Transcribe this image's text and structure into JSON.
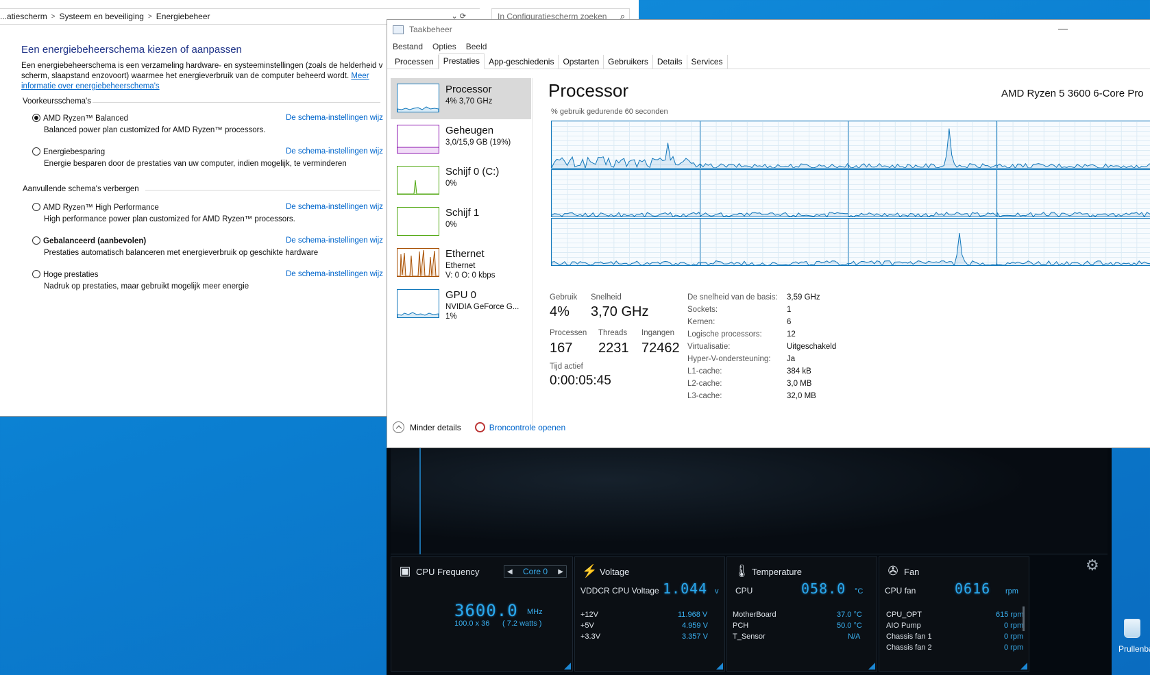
{
  "control_panel": {
    "breadcrumbs": [
      "...atiescherm",
      "Systeem en beveiliging",
      "Energiebeheer"
    ],
    "search_placeholder": "In Configuratiescherm zoeken",
    "title": "Een energiebeheerschema kiezen of aanpassen",
    "description": "Een energiebeheerschema is een verzameling hardware- en systeeminstellingen (zoals de helderheid v scherm, slaapstand enzovoort) waarmee het energieverbruik van de computer beheerd wordt.",
    "description_link": "Meer informatie over energiebeheerschema's",
    "preferred_group": "Voorkeursschema's",
    "extra_group": "Aanvullende schema's verbergen",
    "plan_link_label": "De schema-instellingen wijz",
    "plans": [
      {
        "name": "AMD Ryzen™ Balanced",
        "desc": "Balanced power plan customized for AMD Ryzen™ processors.",
        "selected": true
      },
      {
        "name": "Energiebesparing",
        "desc": "Energie besparen door de prestaties van uw computer, indien mogelijk, te verminderen",
        "selected": false
      },
      {
        "name": "AMD Ryzen™ High Performance",
        "desc": "High performance power plan customized for AMD Ryzen™ processors.",
        "selected": false
      },
      {
        "name": "Gebalanceerd (aanbevolen)",
        "desc": "Prestaties automatisch balanceren met energieverbruik op geschikte hardware",
        "selected": false
      },
      {
        "name": "Hoge prestaties",
        "desc": "Nadruk op prestaties, maar gebruikt mogelijk meer energie",
        "selected": false
      }
    ]
  },
  "task_manager": {
    "title": "Taakbeheer",
    "menu": [
      "Bestand",
      "Opties",
      "Beeld"
    ],
    "tabs": [
      "Processen",
      "Prestaties",
      "App-geschiedenis",
      "Opstarten",
      "Gebruikers",
      "Details",
      "Services"
    ],
    "active_tab": "Prestaties",
    "resources": [
      {
        "name": "Processor",
        "line1": "4% 3,70 GHz",
        "line2": "",
        "color": "#1177bb"
      },
      {
        "name": "Geheugen",
        "line1": "3,0/15,9 GB (19%)",
        "line2": "",
        "color": "#8b12ae"
      },
      {
        "name": "Schijf 0 (C:)",
        "line1": "0%",
        "line2": "",
        "color": "#4da60c"
      },
      {
        "name": "Schijf 1",
        "line1": "0%",
        "line2": "",
        "color": "#4da60c"
      },
      {
        "name": "Ethernet",
        "line1": "Ethernet",
        "line2": "V: 0 O: 0 kbps",
        "color": "#a74f01"
      },
      {
        "name": "GPU 0",
        "line1": "NVIDIA GeForce G...",
        "line2": "1%",
        "color": "#1177bb"
      }
    ],
    "processor": {
      "title": "Processor",
      "model": "AMD Ryzen 5 3600 6-Core Pro",
      "caption": "% gebruik gedurende 60 seconden",
      "usage_label": "Gebruik",
      "usage": "4%",
      "speed_label": "Snelheid",
      "speed": "3,70 GHz",
      "processes_label": "Processen",
      "processes": "167",
      "threads_label": "Threads",
      "threads": "2231",
      "handles_label": "Ingangen",
      "handles": "72462",
      "uptime_label": "Tijd actief",
      "uptime": "0:00:05:45",
      "details": [
        {
          "k": "De snelheid van de basis:",
          "v": "3,59 GHz"
        },
        {
          "k": "Sockets:",
          "v": "1"
        },
        {
          "k": "Kernen:",
          "v": "6"
        },
        {
          "k": "Logische processors:",
          "v": "12"
        },
        {
          "k": "Virtualisatie:",
          "v": "Uitgeschakeld"
        },
        {
          "k": "Hyper-V-ondersteuning:",
          "v": "Ja"
        },
        {
          "k": "L1-cache:",
          "v": "384 kB"
        },
        {
          "k": "L2-cache:",
          "v": "3,0 MB"
        },
        {
          "k": "L3-cache:",
          "v": "32,0 MB"
        }
      ]
    },
    "footer": {
      "less_details": "Minder details",
      "resource_monitor": "Broncontrole openen"
    }
  },
  "hw_monitor": {
    "cpu_freq": {
      "title": "CPU Frequency",
      "core": "Core 0",
      "value": "3600.0",
      "unit": "MHz",
      "multiplier": "100.0  x  36",
      "watts": "( 7.2   watts )"
    },
    "voltage": {
      "title": "Voltage",
      "main_label": "VDDCR CPU Voltage",
      "main_value": "1.044",
      "main_unit": "v",
      "rows": [
        {
          "k": "+12V",
          "v": "11.968  V"
        },
        {
          "k": "+5V",
          "v": "4.959  V"
        },
        {
          "k": "+3.3V",
          "v": "3.357  V"
        }
      ]
    },
    "temperature": {
      "title": "Temperature",
      "main_label": "CPU",
      "main_value": "058.0",
      "main_unit": "°C",
      "rows": [
        {
          "k": "MotherBoard",
          "v": "37.0 °C"
        },
        {
          "k": "PCH",
          "v": "50.0 °C"
        },
        {
          "k": "T_Sensor",
          "v": "N/A"
        }
      ]
    },
    "fan": {
      "title": "Fan",
      "main_label": "CPU fan",
      "main_value": "0616",
      "main_unit": "rpm",
      "rows": [
        {
          "k": "CPU_OPT",
          "v": "615  rpm"
        },
        {
          "k": "AIO Pump",
          "v": "0  rpm"
        },
        {
          "k": "Chassis fan 1",
          "v": "0  rpm"
        },
        {
          "k": "Chassis fan 2",
          "v": "0  rpm"
        }
      ]
    }
  },
  "desktop": {
    "recycle_bin": "Prullenbak"
  }
}
